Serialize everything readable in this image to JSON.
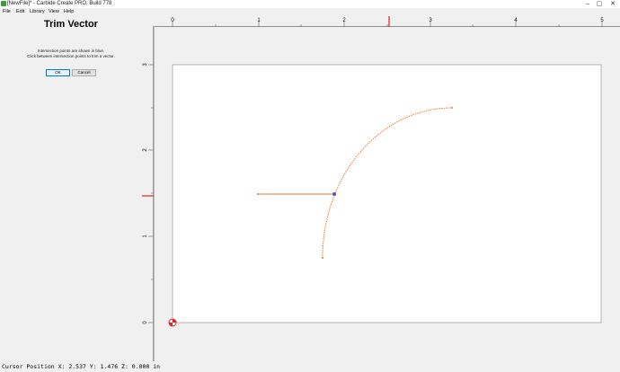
{
  "window": {
    "title": "[NewFile]* - Carbide Create PRO, Build 778",
    "minimize_glyph": "–",
    "maximize_glyph": "▢",
    "close_glyph": "✕"
  },
  "menu": {
    "file": "File",
    "edit": "Edit",
    "library": "Library",
    "view": "View",
    "help": "Help"
  },
  "panel": {
    "title": "Trim Vector",
    "line1": "Intersection points are shown in blue.",
    "line2": "Click between intersection points to trim a vector.",
    "ok_label": "OK",
    "cancel_label": "Cancel"
  },
  "ruler": {
    "top_labels": [
      "0",
      "1",
      "2",
      "3",
      "4",
      "5"
    ],
    "left_labels": [
      "3",
      "2",
      "1",
      "0"
    ],
    "cursor_marker_color": "#e0202a"
  },
  "canvas": {
    "stock_fill": "#ffffff",
    "vector_color": "#f07a2a",
    "intersection_color": "#4060c0",
    "origin_icon": "origin-marker-icon"
  },
  "status": {
    "cursor_position": "Cursor Position X: 2.537 Y: 1.476 Z: 0.000 in"
  }
}
